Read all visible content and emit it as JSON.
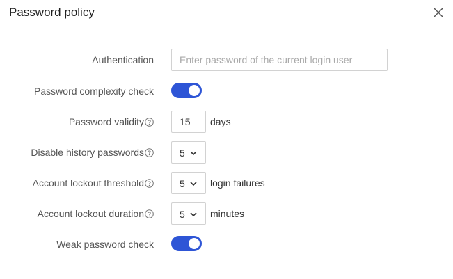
{
  "dialog": {
    "title": "Password policy",
    "close_icon": "close-icon"
  },
  "form": {
    "authentication": {
      "label": "Authentication",
      "placeholder": "Enter password of the current login user",
      "value": ""
    },
    "password_complexity": {
      "label": "Password complexity check",
      "enabled": true
    },
    "password_validity": {
      "label": "Password validity",
      "value": "15",
      "unit": "days"
    },
    "disable_history": {
      "label": "Disable history passwords",
      "value": "5"
    },
    "lockout_threshold": {
      "label": "Account lockout threshold",
      "value": "5",
      "unit": "login failures"
    },
    "lockout_duration": {
      "label": "Account lockout duration",
      "value": "5",
      "unit": "minutes"
    },
    "weak_password": {
      "label": "Weak password check",
      "enabled": true
    }
  },
  "colors": {
    "accent": "#2e55d6",
    "border": "#d2d2d2",
    "label": "#555555"
  }
}
